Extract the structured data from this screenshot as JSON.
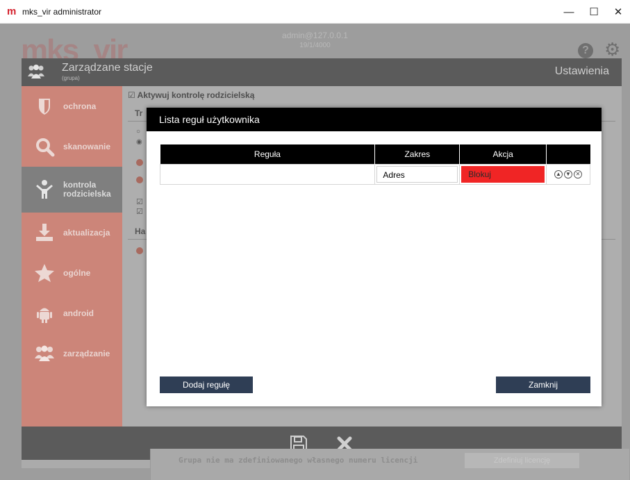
{
  "window": {
    "app_icon": "m",
    "title": "mks_vir administrator",
    "minimize": "—",
    "maximize": "☐",
    "close": "✕"
  },
  "app": {
    "server_line1": "admin@127.0.0.1",
    "server_line2": "19/1/4000",
    "logo_text": "mks_vir",
    "help_icon_glyph": "?",
    "gear_icon_glyph": "⚙"
  },
  "panel": {
    "title": "Zarządzane stacje",
    "subtitle": "(grupa)",
    "right_label": "Ustawienia"
  },
  "sidebar": {
    "items": [
      {
        "label": "ochrona",
        "icon": "shield-icon"
      },
      {
        "label": "skanowanie",
        "icon": "magnifier-icon"
      },
      {
        "label_line1": "kontrola",
        "label_line2": "rodzicielska",
        "icon": "child-icon",
        "active": true
      },
      {
        "label": "aktualizacja",
        "icon": "download-icon"
      },
      {
        "label": "ogólne",
        "icon": "star-icon"
      },
      {
        "label": "android",
        "icon": "android-icon"
      },
      {
        "label": "zarządzanie",
        "icon": "users-icon"
      }
    ]
  },
  "content": {
    "checkbox_label": "Aktywuj kontrolę rodzicielską",
    "tab_fragment": "Tr",
    "section_fragment": "Ha"
  },
  "bottom": {
    "notice": "Grupa nie ma zdefiniowanego własnego numeru licencji",
    "button": "Zdefiniuj licencję"
  },
  "modal": {
    "title": "Lista reguł użytkownika",
    "columns": [
      "Reguła",
      "Zakres",
      "Akcja",
      ""
    ],
    "rows": [
      {
        "rule": "",
        "scope": "Adres",
        "action": "Blokuj"
      }
    ],
    "add_button": "Dodaj regułę",
    "close_button": "Zamknij"
  },
  "colors": {
    "sidebar": "#cc8579",
    "header_dark": "#5b5b5b",
    "modal_header": "#000000",
    "action_block": "#f02525",
    "button": "#2f3e55"
  }
}
